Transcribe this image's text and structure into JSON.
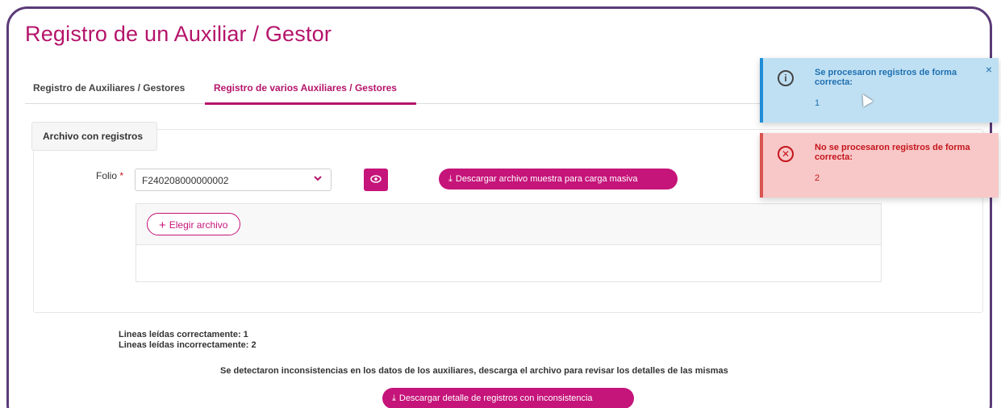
{
  "page": {
    "title": "Registro de un Auxiliar / Gestor"
  },
  "tabs": [
    {
      "label": "Registro de Auxiliares / Gestores",
      "active": false
    },
    {
      "label": "Registro de varios Auxiliares / Gestores",
      "active": true
    }
  ],
  "form": {
    "panel_title": "Archivo con registros",
    "folio_label": "Folio",
    "required_mark": "*",
    "folio_value": "F240208000000002",
    "sample_button": "Descargar archivo muestra para carga masiva",
    "choose_file_button": "Elegir archivo"
  },
  "results": {
    "lines_ok": "Lineas leídas correctamente: 1",
    "lines_bad": "Lineas leídas incorrectamente: 2",
    "inconsistency_msg": "Se detectaron inconsistencias en los datos de los auxiliares, descarga el archivo para revisar los detalles de las mismas",
    "detail_button": "Descargar detalle de registros con inconsistencia"
  },
  "toasts": {
    "success": {
      "message": "Se procesaron registros de forma correcta:",
      "value": "1",
      "close": "×",
      "icon": "info-icon"
    },
    "error": {
      "message": "No se procesaron registros de forma correcta:",
      "value": "2",
      "icon": "error-circle-icon"
    }
  },
  "colors": {
    "brand": "#c5147a",
    "title": "#b5146a",
    "info": "#1f8dd6",
    "error": "#d9534f"
  }
}
